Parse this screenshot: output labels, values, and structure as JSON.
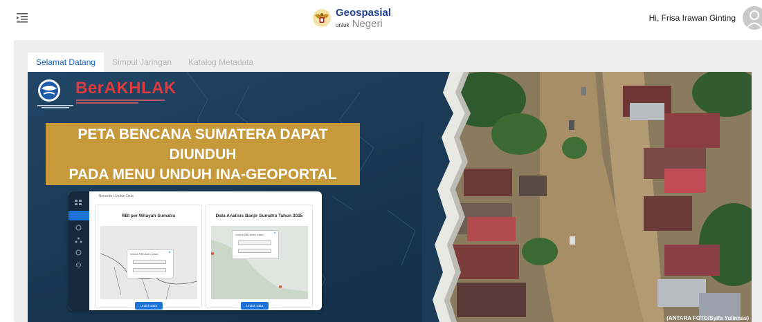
{
  "header": {
    "menu_icon": "menu-collapse-icon",
    "brand_title": "Geospasial",
    "brand_small": "untuk",
    "brand_sub": "Negeri",
    "greeting": "Hi, Frisa Irawan Ginting",
    "avatar_icon": "user-avatar-icon"
  },
  "tabs": [
    {
      "label": "Selamat Datang",
      "active": true
    },
    {
      "label": "Simpul Jaringan",
      "active": false
    },
    {
      "label": "Katalog Metadata",
      "active": false
    }
  ],
  "banner": {
    "brand_word": "BerAKHLAK",
    "headline_line1": "PETA BENCANA SUMATERA DAPAT DIUNDUH",
    "headline_line2": "PADA MENU UNDUH INA-GEOPORTAL",
    "mock": {
      "breadcrumb": "Beranda / Unduh Data",
      "panel1_title": "RBI per Wilayah Sumatra",
      "panel2_title": "Data Analisis Banjir Sumatra Tahun 2025",
      "popup_title1": "Unduh RBI Aceh Utara",
      "popup_title2": "Unduh RBI Aceh Utara",
      "button_label": "Unduh Data"
    },
    "credit": "(ANTARA FOTO/Syifa Yulinnas)"
  },
  "colors": {
    "accent": "#1a66c9",
    "brand_blue": "#1f3f8f",
    "banner_navy": "#1c3d5c",
    "headline_gold": "#c69a3a",
    "berakhlak_red": "#e0393e"
  }
}
